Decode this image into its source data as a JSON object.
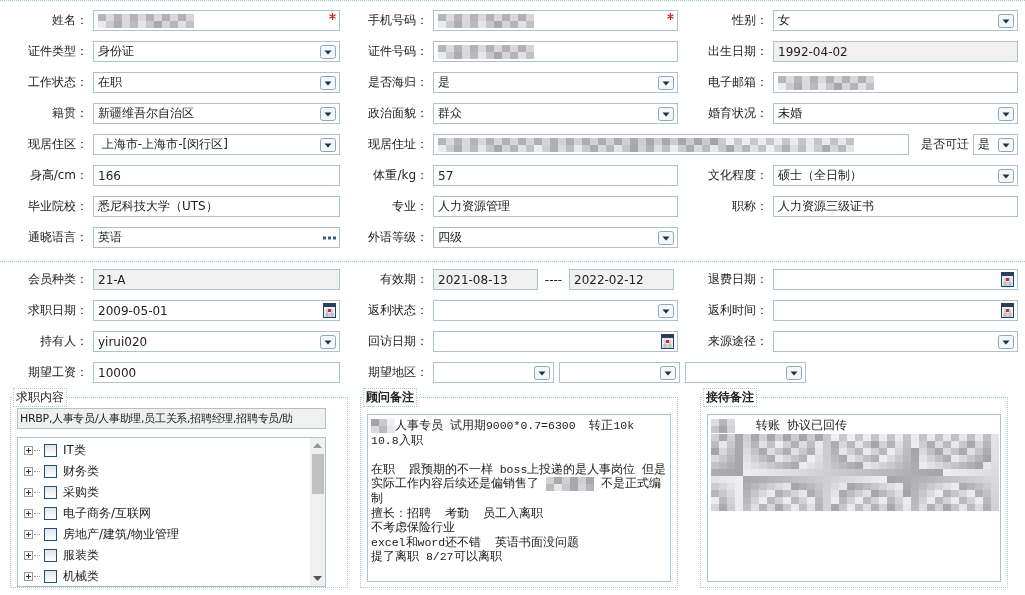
{
  "profile_rows": [
    {
      "cells": [
        {
          "label": "姓名：",
          "kind": "text",
          "masked": true,
          "required": true
        },
        {
          "label": "手机号码：",
          "kind": "text",
          "masked": true,
          "required": true
        },
        {
          "label": "性别：",
          "kind": "select",
          "value": "女"
        }
      ]
    },
    {
      "cells": [
        {
          "label": "证件类型：",
          "kind": "select",
          "value": "身份证"
        },
        {
          "label": "证件号码：",
          "kind": "text",
          "masked": true
        },
        {
          "label": "出生日期：",
          "kind": "text",
          "value": "1992-04-02",
          "readonly": true
        }
      ]
    },
    {
      "cells": [
        {
          "label": "工作状态：",
          "kind": "select",
          "value": "在职"
        },
        {
          "label": "是否海归：",
          "kind": "select",
          "value": "是"
        },
        {
          "label": "电子邮箱：",
          "kind": "text",
          "masked": true
        }
      ]
    },
    {
      "cells": [
        {
          "label": "籍贯：",
          "kind": "select",
          "value": "新疆维吾尔自治区"
        },
        {
          "label": "政治面貌：",
          "kind": "select",
          "value": "群众"
        },
        {
          "label": "婚育状况：",
          "kind": "select",
          "value": "未婚"
        }
      ]
    },
    {
      "cells": [
        {
          "label": "现居住区：",
          "kind": "select",
          "value": " 上海市-上海市-[闵行区]"
        },
        {
          "label": "现居住址：",
          "kind": "text",
          "masked": true,
          "wide": true,
          "extra": {
            "label": "是否可迁",
            "kind": "select",
            "value": "是"
          }
        }
      ]
    },
    {
      "cells": [
        {
          "label": "身高/cm：",
          "kind": "text",
          "value": "166"
        },
        {
          "label": "体重/kg：",
          "kind": "text",
          "value": "57"
        },
        {
          "label": "文化程度：",
          "kind": "select",
          "value": "硕士（全日制）"
        }
      ]
    },
    {
      "cells": [
        {
          "label": "毕业院校：",
          "kind": "text",
          "value": "悉尼科技大学（UTS）"
        },
        {
          "label": "专业：",
          "kind": "text",
          "value": "人力资源管理"
        },
        {
          "label": "职称：",
          "kind": "text",
          "value": "人力资源三级证书"
        }
      ]
    },
    {
      "cells": [
        {
          "label": "通晓语言：",
          "kind": "lookup",
          "value": "英语"
        },
        {
          "label": "外语等级：",
          "kind": "select",
          "value": "四级"
        }
      ]
    }
  ],
  "membership_rows": [
    {
      "cells": [
        {
          "label": "会员种类：",
          "kind": "text",
          "value": "21-A",
          "readonly": true
        },
        {
          "label": "有效期：",
          "kind": "range",
          "separator": "----",
          "fields": [
            {
              "kind": "text",
              "value": "2021-08-13",
              "readonly": true
            },
            {
              "kind": "text",
              "value": "2022-02-12",
              "readonly": true
            }
          ]
        },
        {
          "label": "退费日期：",
          "kind": "date"
        }
      ]
    },
    {
      "cells": [
        {
          "label": "求职日期：",
          "kind": "date",
          "value": "2009-05-01"
        },
        {
          "label": "返利状态：",
          "kind": "select"
        },
        {
          "label": "返利时间：",
          "kind": "date"
        }
      ]
    },
    {
      "cells": [
        {
          "label": "持有人：",
          "kind": "select",
          "value": "yirui020"
        },
        {
          "label": "回访日期：",
          "kind": "date"
        },
        {
          "label": "来源途径：",
          "kind": "select"
        }
      ]
    },
    {
      "cells": [
        {
          "label": "期望工资：",
          "kind": "text",
          "value": "10000"
        },
        {
          "label": "期望地区：",
          "kind": "group",
          "fields": [
            {
              "kind": "select"
            },
            {
              "kind": "select"
            },
            {
              "kind": "select"
            }
          ]
        }
      ]
    }
  ],
  "job_panel": {
    "title": "求职内容",
    "selected_text": "HRBP,人事专员/人事助理,员工关系,招聘经理,招聘专员/助",
    "categories": [
      {
        "label": "IT类",
        "checked": false,
        "expanded": false
      },
      {
        "label": "财务类",
        "checked": false,
        "expanded": false
      },
      {
        "label": "采购类",
        "checked": false,
        "expanded": false
      },
      {
        "label": "电子商务/互联网",
        "checked": false,
        "expanded": false
      },
      {
        "label": "房地产/建筑/物业管理",
        "checked": false,
        "expanded": false
      },
      {
        "label": "服装类",
        "checked": false,
        "expanded": false
      },
      {
        "label": "机械类",
        "checked": false,
        "expanded": false
      }
    ]
  },
  "notes": [
    {
      "title": "顾问备注",
      "lines": [
        {
          "kind": "text",
          "parts": [
            {
              "kind": "redacted"
            },
            {
              "kind": "text",
              "text": "人事专员 试用期9000*0.7=6300  转正10k"
            }
          ]
        },
        {
          "kind": "text",
          "parts": [
            {
              "kind": "text",
              "text": "10.8入职"
            }
          ]
        },
        {
          "kind": "blank"
        },
        {
          "kind": "text",
          "parts": [
            {
              "kind": "text",
              "text": "在职  跟预期的不一样 boss上投递的是人事岗位 但是实际工作内容后续还是偏销售了 "
            },
            {
              "kind": "redacted"
            },
            {
              "kind": "text",
              "text": " 不是正式编制"
            }
          ]
        },
        {
          "kind": "text",
          "parts": [
            {
              "kind": "text",
              "text": "擅长：招聘  考勤  员工入离职"
            }
          ]
        },
        {
          "kind": "text",
          "parts": [
            {
              "kind": "text",
              "text": "不考虑保险行业"
            }
          ]
        },
        {
          "kind": "text",
          "parts": [
            {
              "kind": "text",
              "text": "excel和word还不错  英语书面没问题"
            }
          ]
        },
        {
          "kind": "text",
          "parts": [
            {
              "kind": "text",
              "text": "提了离职 8/27可以离职"
            }
          ]
        }
      ]
    },
    {
      "title": "接待备注",
      "lines": [
        {
          "kind": "text",
          "parts": [
            {
              "kind": "redacted"
            },
            {
              "kind": "text",
              "text": "   转账 协议已回传"
            }
          ]
        },
        {
          "kind": "redacted-block"
        }
      ]
    }
  ]
}
